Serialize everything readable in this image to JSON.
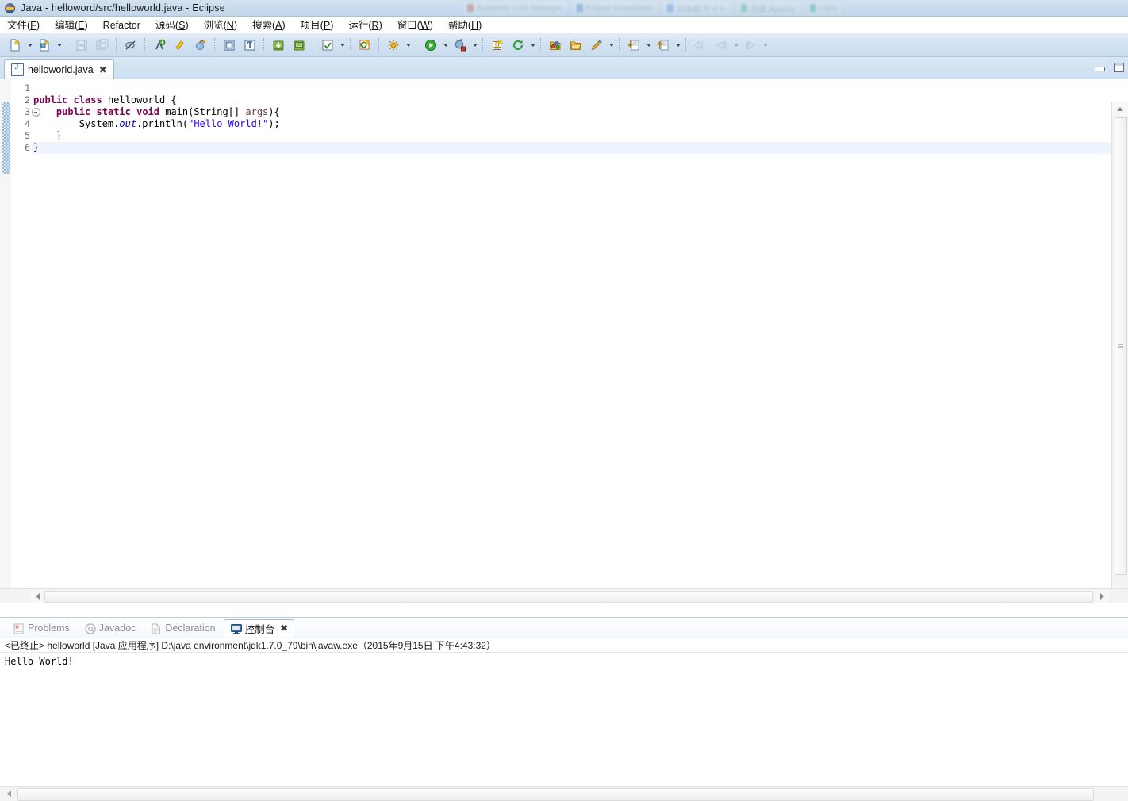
{
  "window": {
    "title": "Java  -  helloword/src/helloworld.java  -  Eclipse",
    "logo_icon": "eclipse-logo-icon"
  },
  "menubar": {
    "items": [
      {
        "label": "文件(F)",
        "mnemonic": "F"
      },
      {
        "label": "编辑(E)",
        "mnemonic": "E"
      },
      {
        "label": "Refactor",
        "mnemonic": ""
      },
      {
        "label": "源码(S)",
        "mnemonic": "S"
      },
      {
        "label": "浏览(N)",
        "mnemonic": "N"
      },
      {
        "label": "搜索(A)",
        "mnemonic": "A"
      },
      {
        "label": "项目(P)",
        "mnemonic": "P"
      },
      {
        "label": "运行(R)",
        "mnemonic": "R"
      },
      {
        "label": "窗口(W)",
        "mnemonic": "W"
      },
      {
        "label": "帮助(H)",
        "mnemonic": "H"
      }
    ]
  },
  "toolbar": {
    "buttons": [
      "new-wizard-icon",
      "new-java-class-icon",
      "save-icon",
      "save-all-icon",
      "toggle-breakpoint-icon",
      "toggle-mark-occurrences-icon",
      "build-all-icon",
      "debug-last-icon",
      "open-type-icon",
      "open-task-icon",
      "import-icon",
      "export-icon",
      "check-icon",
      "new-annotation-icon",
      "external-tools-icon",
      "run-icon",
      "debug-icon",
      "new-java-project-icon",
      "refresh-icon",
      "open-resource-icon",
      "open-folder-icon",
      "edit-icon",
      "previous-annotation-icon",
      "next-annotation-icon",
      "back-nav-icon",
      "backward-history-icon",
      "forward-history-icon"
    ]
  },
  "editor": {
    "tab": {
      "label": "helloworld.java",
      "icon": "java-file-icon",
      "close_glyph": "✖",
      "active": true
    },
    "window_controls": {
      "minimize": "minimize-icon",
      "maximize": "maximize-icon"
    },
    "gutter": {
      "line_numbers": [
        "1",
        "2",
        "3",
        "4",
        "5",
        "6"
      ],
      "fold_markers": {
        "3": "fold-collapse-icon"
      },
      "change_bar_lines": [
        2,
        3,
        4,
        5,
        6
      ]
    },
    "current_line": 6,
    "code_lines": [
      {
        "n": 1,
        "tokens": []
      },
      {
        "n": 2,
        "tokens": [
          {
            "t": "public",
            "c": "kw"
          },
          {
            "t": " ",
            "c": "plain"
          },
          {
            "t": "class",
            "c": "kw"
          },
          {
            "t": " helloworld {",
            "c": "plain"
          }
        ]
      },
      {
        "n": 3,
        "tokens": [
          {
            "t": "    ",
            "c": "plain"
          },
          {
            "t": "public",
            "c": "kw"
          },
          {
            "t": " ",
            "c": "plain"
          },
          {
            "t": "static",
            "c": "kw"
          },
          {
            "t": " ",
            "c": "plain"
          },
          {
            "t": "void",
            "c": "kw"
          },
          {
            "t": " main(String[] ",
            "c": "plain"
          },
          {
            "t": "args",
            "c": "par"
          },
          {
            "t": "){",
            "c": "plain"
          }
        ]
      },
      {
        "n": 4,
        "tokens": [
          {
            "t": "        System.",
            "c": "plain"
          },
          {
            "t": "out",
            "c": "fld"
          },
          {
            "t": ".println(",
            "c": "plain"
          },
          {
            "t": "\"Hello World!\"",
            "c": "str"
          },
          {
            "t": ");",
            "c": "plain"
          }
        ]
      },
      {
        "n": 5,
        "tokens": [
          {
            "t": "    }",
            "c": "plain"
          }
        ]
      },
      {
        "n": 6,
        "tokens": [
          {
            "t": "}",
            "c": "plain"
          }
        ]
      }
    ],
    "scrollbars": {
      "vertical_arrow_up": "scroll-up-arrow-icon",
      "vertical_arrow_down": "scroll-down-arrow-icon",
      "horizontal_arrow_left": "scroll-left-arrow-icon",
      "horizontal_arrow_right": "scroll-right-arrow-icon"
    }
  },
  "bottom_panel": {
    "tabs": [
      {
        "label": "Problems",
        "icon": "problems-icon",
        "active": false,
        "closable": false
      },
      {
        "label": "Javadoc",
        "icon": "javadoc-icon",
        "active": false,
        "closable": false
      },
      {
        "label": "Declaration",
        "icon": "declaration-icon",
        "active": false,
        "closable": false
      },
      {
        "label": "控制台",
        "icon": "console-icon",
        "active": true,
        "closable": true,
        "close_glyph": "✖"
      }
    ],
    "console": {
      "status_line": "<已终止> helloworld [Java 应用程序] D:\\java environment\\jdk1.7.0_79\\bin\\javaw.exe（2015年9月15日 下午4:43:32）",
      "output": "Hello World!"
    }
  },
  "colors": {
    "titlebar_gradient_top": "#d5e2f0",
    "titlebar_gradient_bottom": "#c2d6ea",
    "toolbar_gradient_top": "#e2ecf7",
    "toolbar_gradient_bottom": "#c9dcee",
    "tab_border": "#9fbcd8",
    "keyword": "#7f0055",
    "string": "#2a00ff",
    "parameter": "#6a3e3e",
    "static_field": "#0000c0",
    "current_line_highlight": "#edf4fd",
    "change_bar": "#8fb8e0",
    "editor_bg": "#ffffff"
  }
}
